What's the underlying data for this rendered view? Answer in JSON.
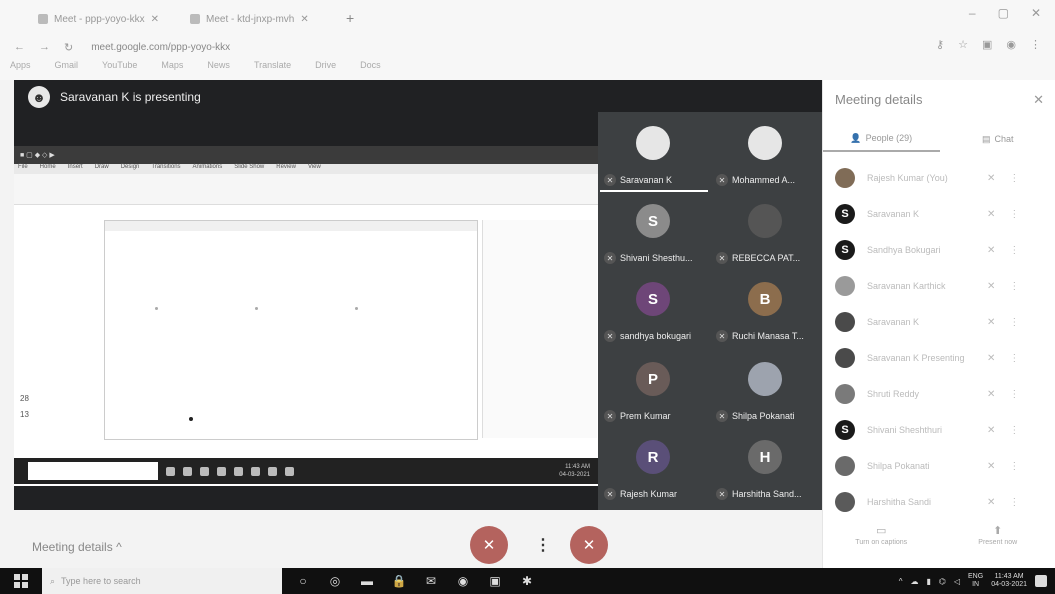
{
  "browser": {
    "tabs": [
      {
        "label": "Meet - ppp-yoyo-kkx"
      },
      {
        "label": "Meet - ktd-jnxp-mvh"
      }
    ],
    "url": "meet.google.com/ppp-yoyo-kkx",
    "window_controls": [
      "–",
      "▢",
      "✕"
    ],
    "bookmarks": [
      "Apps",
      "Gmail",
      "YouTube",
      "Maps",
      "News",
      "Translate",
      "Drive",
      "Docs"
    ]
  },
  "stage": {
    "presenter_text": "Saravanan K is presenting"
  },
  "shared_screen": {
    "ribbon_tabs": [
      "File",
      "Home",
      "Insert",
      "Draw",
      "Design",
      "Transitions",
      "Animations",
      "Slide Show",
      "Review",
      "View"
    ],
    "slide_numbers": [
      "28",
      "13"
    ],
    "clock_time": "11:43 AM",
    "clock_date": "04-03-2021"
  },
  "participants": [
    {
      "name": "Saravanan K",
      "initial": "",
      "color": "#e6e6e6",
      "active": true
    },
    {
      "name": "Mohammed A...",
      "initial": "",
      "color": "#e6e6e6",
      "active": false
    },
    {
      "name": "Shivani Shesthu...",
      "initial": "S",
      "color": "#8b8b8b",
      "active": false
    },
    {
      "name": "REBECCA PAT...",
      "initial": "",
      "color": "#555555",
      "active": false
    },
    {
      "name": "sandhya bokugari",
      "initial": "S",
      "color": "#7d3f8c",
      "active": false
    },
    {
      "name": "Ruchi Manasa T...",
      "initial": "B",
      "color": "#9a6b3a",
      "active": false
    },
    {
      "name": "Prem Kumar",
      "initial": "P",
      "color": "#6f5a55",
      "active": false
    },
    {
      "name": "Shilpa Pokanati",
      "initial": "",
      "color": "#9aa3b5",
      "active": false
    },
    {
      "name": "Rajesh Kumar",
      "initial": "R",
      "color": "#5d4c8c",
      "active": false
    },
    {
      "name": "Harshitha Sand...",
      "initial": "H",
      "color": "#6a6a6a",
      "active": false
    }
  ],
  "meetbar": {
    "details_label": "Meeting details",
    "details_arrow": "^",
    "mic_icon": "✕",
    "more_icon": "⋮",
    "cam_icon": "✕"
  },
  "panel": {
    "title": "Meeting details",
    "close": "✕",
    "tabs": [
      {
        "label": "People (29)",
        "icon": "👤"
      },
      {
        "label": "Chat",
        "icon": "▤"
      }
    ],
    "people": [
      {
        "name": "Rajesh Kumar (You)",
        "initial": "",
        "color": "#8a6a4a"
      },
      {
        "name": "Saravanan K",
        "initial": "S",
        "color": "#1a1a1a"
      },
      {
        "name": "Sandhya Bokugari",
        "initial": "S",
        "color": "#1a1a1a"
      },
      {
        "name": "Saravanan Karthick",
        "initial": "",
        "color": "#9a9a9a"
      },
      {
        "name": "Saravanan K",
        "initial": "",
        "color": "#4a4a4a"
      },
      {
        "name": "Saravanan K Presenting",
        "initial": "",
        "color": "#4a4a4a"
      },
      {
        "name": "Shruti Reddy",
        "initial": "",
        "color": "#7a7a7a"
      },
      {
        "name": "Shivani Sheshthuri",
        "initial": "S",
        "color": "#1a1a1a"
      },
      {
        "name": "Shilpa Pokanati",
        "initial": "",
        "color": "#6a6a6a"
      },
      {
        "name": "Harshitha Sandi",
        "initial": "",
        "color": "#5a5a5a"
      }
    ],
    "footer": [
      {
        "label": "Turn on captions",
        "icon": "▭"
      },
      {
        "label": "Present now",
        "icon": "⬆"
      }
    ]
  },
  "taskbar": {
    "search_placeholder": "Type here to search",
    "apps": [
      "○",
      "◎",
      "▬",
      "🔒",
      "✉",
      "◉",
      "▣",
      "✱"
    ],
    "lang_top": "ENG",
    "lang_bottom": "IN",
    "time": "11:43 AM",
    "date": "04-03-2021"
  }
}
